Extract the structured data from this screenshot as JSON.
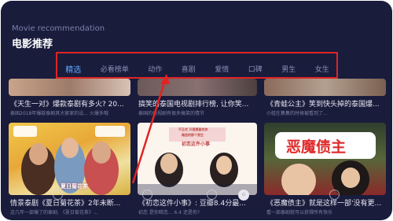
{
  "header": {
    "subtitle": "Movie recommendation",
    "title": "电影推荐"
  },
  "tabs": [
    {
      "label": "精选",
      "active": true
    },
    {
      "label": "必看榜单"
    },
    {
      "label": "动作"
    },
    {
      "label": "喜剧"
    },
    {
      "label": "爱情"
    },
    {
      "label": "口碑"
    },
    {
      "label": "男生"
    },
    {
      "label": "女生"
    }
  ],
  "cards_row1": [
    {
      "caption": "《天生一对》爆款泰剧有多火? 20...",
      "desc": "泰国2018年爆款泰剧其大家家的设... 火爆多哦"
    },
    {
      "caption": "搞笑的泰国电视剧排行榜, 让你笑...",
      "desc": "泰国的电视剧有很多搞笑的情节"
    },
    {
      "caption": "《青蛙公主》笑到快头掉的泰国爆...",
      "desc": "小蛙在集集的时候被看到了..."
    }
  ],
  "cards_row2": [
    {
      "caption": "情景泰剧《夏日菊花茶》2年未断...",
      "desc": "这几年一部爆了的泰剧, 《夏日菊花茶》...",
      "poster_text": "夏日菊花茶"
    },
    {
      "caption": "《初恋这件小事》: 豆瓣8.4分最...",
      "desc": "初恋 是你暗恋... 6.4 还是你?",
      "poster_lines": [
        "不正式 只是想喜欢你",
        "暗恋的那个男生",
        "初恋这件小事"
      ]
    },
    {
      "caption": "《恶魔债主》就是这样一部'没有更...",
      "desc": "看一部泰剧就可以获得所有快乐",
      "poster_text": "恶魔债主"
    }
  ],
  "colors": {
    "accent": "#5ea8ff",
    "highlight": "#e02424"
  }
}
